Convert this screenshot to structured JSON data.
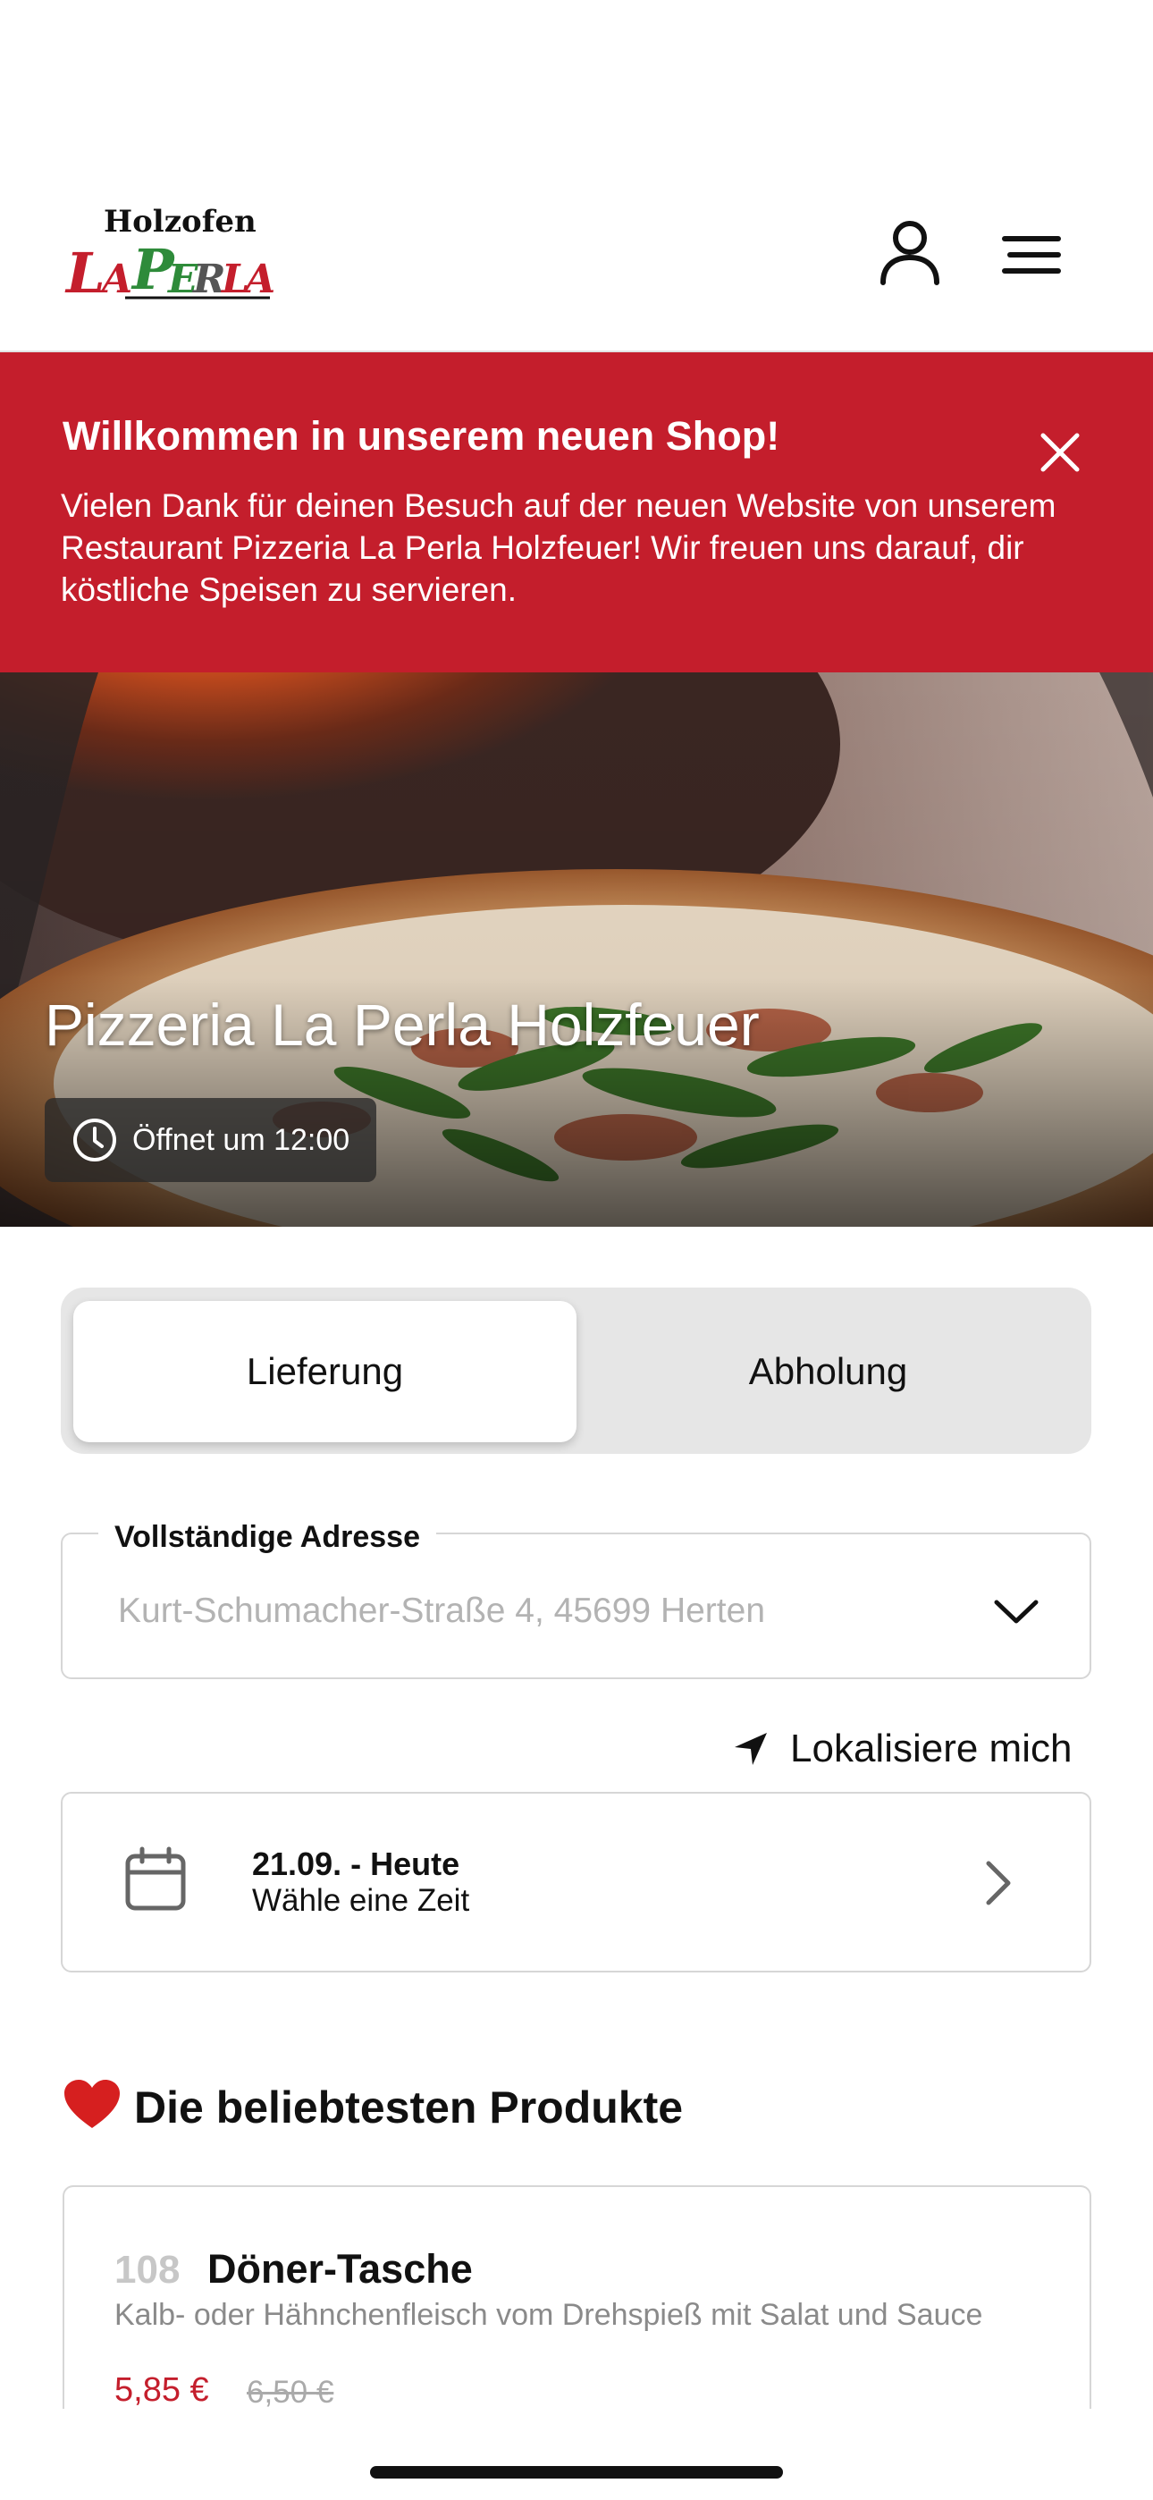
{
  "header": {
    "logo_top": "Holzofen",
    "logo_bottom": "LaPerla",
    "account_icon": "user-icon",
    "menu_icon": "menu-icon"
  },
  "banner": {
    "title": "Willkommen in unserem neuen Shop!",
    "text": "Vielen Dank für deinen Besuch auf der neuen Website von unserem Restaurant Pizzeria La Perla Holzfeuer! Wir freuen uns darauf, dir köstliche Speisen zu servieren.",
    "close_icon": "close-icon",
    "color": "#c41e2c"
  },
  "hero": {
    "title": "Pizzeria La Perla Holzfeuer",
    "status": "Öffnet um 12:00",
    "status_icon": "clock-icon"
  },
  "order_mode": {
    "options": [
      "Lieferung",
      "Abholung"
    ],
    "selected": "Lieferung"
  },
  "address": {
    "label": "Vollständige Adresse",
    "placeholder": "Kurt-Schumacher-Straße 4, 45699 Herten"
  },
  "locate": {
    "label": "Lokalisiere mich",
    "icon": "location-arrow-icon"
  },
  "schedule": {
    "date": "21.09. - Heute",
    "prompt": "Wähle eine Zeit",
    "icon": "calendar-icon"
  },
  "popular": {
    "title": "Die beliebtesten Produkte",
    "icon": "heart-icon",
    "products": [
      {
        "number": "108",
        "name": "Döner-Tasche",
        "description": "Kalb- oder Hähnchenfleisch vom Drehspieß mit Salat und Sauce",
        "price": "5,85 €",
        "old_price": "6,50 €"
      }
    ]
  },
  "colors": {
    "brand_red": "#c41e2c",
    "logo_green": "#2e8b3a"
  }
}
